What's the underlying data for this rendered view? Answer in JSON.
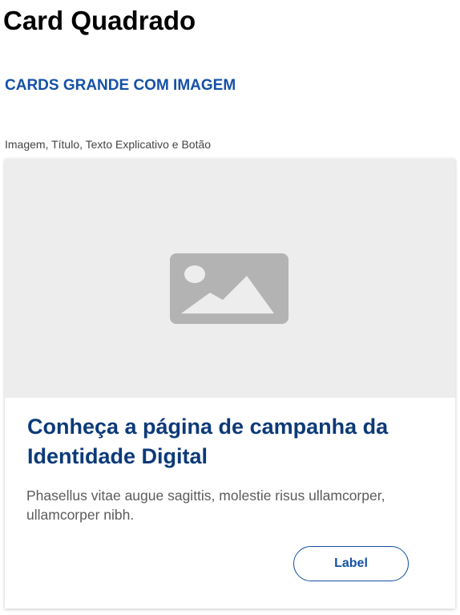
{
  "page": {
    "title": "Card Quadrado",
    "section_heading": "CARDS GRANDE COM IMAGEM",
    "section_caption": "Imagem, Título, Texto Explicativo e Botão"
  },
  "card": {
    "image_icon": "image-placeholder-icon",
    "title": "Conheça a página de campanha da Identidade Digital",
    "text": "Phasellus vitae augue sagittis, molestie risus ullamcorper, ullamcorper nibh.",
    "button_label": "Label"
  },
  "colors": {
    "heading_blue": "#1551a5",
    "title_navy": "#0c3a78",
    "body_gray": "#5b5b5b",
    "image_bg": "#ededed",
    "icon_gray": "#b3b3b3"
  }
}
